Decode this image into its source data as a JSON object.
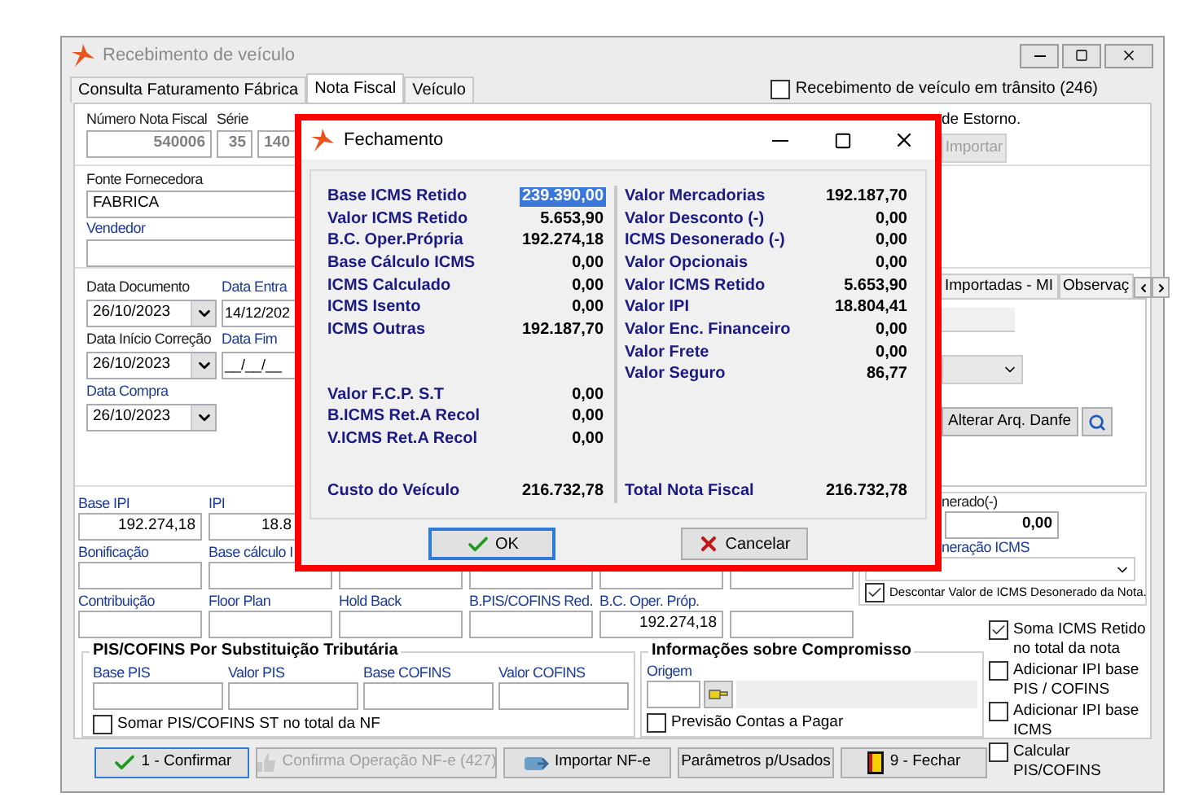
{
  "window": {
    "title": "Recebimento de veículo"
  },
  "tabs": [
    {
      "label": "Consulta Faturamento Fábrica",
      "selected": false
    },
    {
      "label": "Nota Fiscal",
      "selected": true
    },
    {
      "label": "Veículo",
      "selected": false
    }
  ],
  "in_transit": {
    "label": "Recebimento de veículo em trânsito (246)",
    "checked": false
  },
  "header": {
    "fields": [
      {
        "label": "Número Nota Fiscal",
        "value": "540006"
      },
      {
        "label": "Série",
        "value": "35"
      },
      {
        "value": "140"
      }
    ],
    "estorno": {
      "label": "de Estorno."
    },
    "import_button": {
      "label": "Importar",
      "disabled": true
    }
  },
  "supplier": {
    "label": "Fonte Fornecedora",
    "value": "FABRICA",
    "seller_label": "Vendedor"
  },
  "dates": [
    {
      "label": "Data Documento",
      "value": "26/10/2023",
      "kind": "combo"
    },
    {
      "label": "Data Entra",
      "value": "14/12/202",
      "kind": "plain"
    },
    {
      "label": "Data Início Correção",
      "value": "26/10/2023",
      "kind": "combo"
    },
    {
      "label": "Data Fim",
      "value": "__/__/__",
      "kind": "plain"
    },
    {
      "label": "Data Compra",
      "value": "26/10/2023",
      "kind": "combo"
    }
  ],
  "side_panel": {
    "tabs": [
      {
        "label": "Importadas - MI",
        "selected": false
      },
      {
        "label": "Observaç",
        "selected": false
      }
    ],
    "danfe_button": "Alterar Arq. Danfe"
  },
  "value_rows": [
    [
      {
        "label": "Base IPI",
        "value": "192.274,18"
      },
      {
        "label": "IPI",
        "value": "18.8"
      }
    ],
    [
      {
        "label": "Bonificação"
      },
      {
        "label": "Base cálculo I"
      }
    ],
    [
      {
        "label": "Contribuição"
      },
      {
        "label": "Floor Plan"
      },
      {
        "label": "Hold Back"
      },
      {
        "label": "B.PIS/COFINS Red."
      },
      {
        "label": "B.C. Oper. Próp.",
        "value": "192.274,18"
      }
    ]
  ],
  "desonerado": {
    "title": "nerado(-)",
    "value": "0,00",
    "reason_label": "neração ICMS",
    "discount": {
      "label": "Descontar Valor de ICMS Desonerado da Nota.",
      "checked": true
    }
  },
  "pis_cofins_st": {
    "title": "PIS/COFINS Por Substituição Tributária",
    "fields": [
      {
        "label": "Base PIS"
      },
      {
        "label": "Valor PIS"
      },
      {
        "label": "Base COFINS"
      },
      {
        "label": "Valor COFINS"
      }
    ],
    "sum": {
      "label": "Somar PIS/COFINS ST no total da NF",
      "checked": false
    }
  },
  "compromisso": {
    "title": "Informações sobre Compromisso",
    "origin_label": "Origem",
    "forecast": {
      "label": "Previsão Contas a Pagar",
      "checked": false
    }
  },
  "options": [
    {
      "label": "Soma ICMS Retido no total da nota",
      "checked": true
    },
    {
      "label": "Adicionar IPI base PIS / COFINS",
      "checked": false
    },
    {
      "label": "Adicionar IPI base ICMS",
      "checked": false
    },
    {
      "label": "Calcular PIS/COFINS",
      "checked": false
    }
  ],
  "buttons": [
    {
      "label": "1 - Confirmar",
      "kind": "confirm",
      "disabled": false
    },
    {
      "label": "Confirma Operação NF-e  (427)",
      "kind": "thumb",
      "disabled": true
    },
    {
      "label": "Importar  NF-e",
      "kind": "import",
      "disabled": false
    },
    {
      "label": "Parâmetros p/Usados",
      "kind": "plain",
      "disabled": false
    },
    {
      "label": "9 - Fechar",
      "kind": "exit",
      "disabled": false
    }
  ],
  "dialog": {
    "title": "Fechamento",
    "left_sections": [
      {
        "rows": [
          {
            "label": "Base ICMS Retido",
            "value": "239.390,00",
            "selected": true
          },
          {
            "label": "Valor ICMS Retido",
            "value": "5.653,90",
            "selected": false
          },
          {
            "label": "B.C. Oper.Própria",
            "value": "192.274,18",
            "selected": false
          },
          {
            "label": "Base Cálculo ICMS",
            "value": "0,00",
            "selected": false
          },
          {
            "label": "ICMS Calculado",
            "value": "0,00",
            "selected": false
          },
          {
            "label": "ICMS Isento",
            "value": "0,00",
            "selected": false
          },
          {
            "label": "ICMS Outras",
            "value": "192.187,70",
            "selected": false
          }
        ]
      },
      {
        "rows": [
          {
            "label": "Valor F.C.P. S.T",
            "value": "0,00",
            "selected": false
          },
          {
            "label": "B.ICMS Ret.A Recol",
            "value": "0,00",
            "selected": false
          },
          {
            "label": "V.ICMS Ret.A Recol",
            "value": "0,00",
            "selected": false
          }
        ]
      }
    ],
    "left_total": {
      "label": "Custo do Veículo",
      "value": "216.732,78"
    },
    "right_rows": [
      {
        "label": "Valor Mercadorias",
        "value": "192.187,70",
        "selected": false
      },
      {
        "label": "Valor Desconto (-)",
        "value": "0,00",
        "selected": false
      },
      {
        "label": "ICMS Desonerado (-)",
        "value": "0,00",
        "selected": false
      },
      {
        "label": "Valor Opcionais",
        "value": "0,00",
        "selected": false
      },
      {
        "label": "Valor ICMS Retido",
        "value": "5.653,90",
        "selected": false
      },
      {
        "label": "Valor IPI",
        "value": "18.804,41",
        "selected": false
      },
      {
        "label": "Valor Enc. Financeiro",
        "value": "0,00",
        "selected": false
      },
      {
        "label": "Valor Frete",
        "value": "0,00",
        "selected": false
      },
      {
        "label": "Valor Seguro",
        "value": "86,77",
        "selected": false
      }
    ],
    "right_total": {
      "label": "Total Nota Fiscal",
      "value": "216.732,78"
    },
    "buttons": [
      {
        "label": "OK",
        "kind": "ok"
      },
      {
        "label": "Cancelar",
        "kind": "cancel"
      }
    ]
  }
}
